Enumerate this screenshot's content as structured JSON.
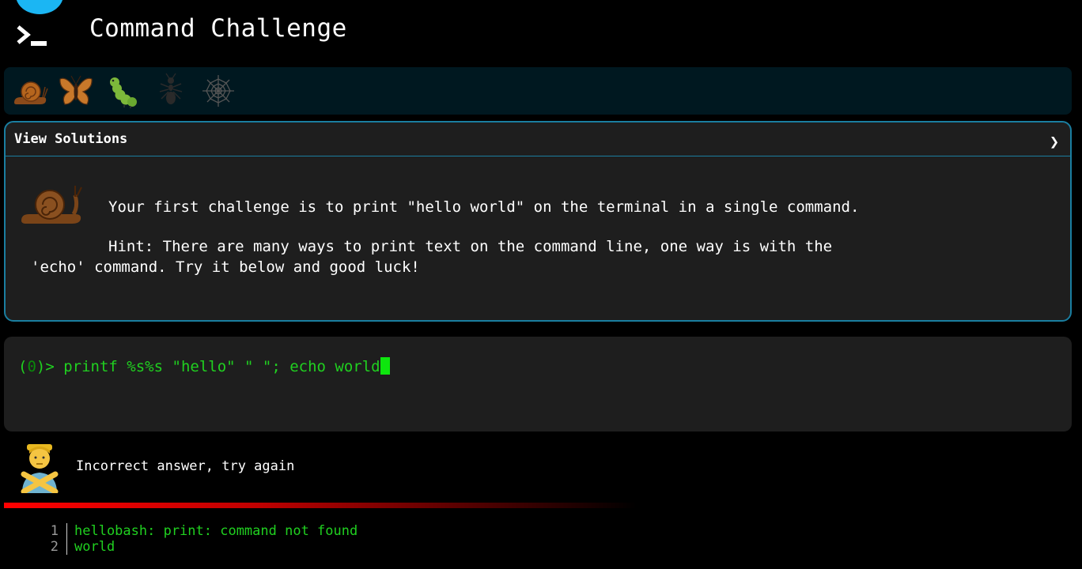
{
  "header": {
    "title": "Command Challenge",
    "accent_color": "#1bb6f3",
    "logo_icon": "terminal-prompt-icon"
  },
  "levels": [
    {
      "name": "snail-icon",
      "color": "#b5651d"
    },
    {
      "name": "butterfly-icon",
      "color": "#c8782a"
    },
    {
      "name": "caterpillar-icon",
      "color": "#7cb83a"
    },
    {
      "name": "ant-icon",
      "color": "#333333"
    },
    {
      "name": "spider-web-icon",
      "color": "#555555"
    }
  ],
  "panel": {
    "solutions_label": "View Solutions",
    "chevron": "❯",
    "challenge_text": "Your first challenge is to print \"hello world\" on the terminal in a single command.",
    "hint_line1": "Hint: There are many ways to print text on the command line, one way is with the",
    "hint_line2": "'echo' command. Try it below and good luck!",
    "border_color": "#1a7ea0"
  },
  "terminal": {
    "prompt_open": "(",
    "exit_code": "0",
    "prompt_close": ")> ",
    "command": "printf %s%s \"hello\" \" \"; echo world"
  },
  "feedback": {
    "message": "Incorrect answer, try again",
    "status_color": "#ff0000"
  },
  "output": {
    "lines": [
      {
        "num": "1",
        "text": "hellobash: print: command not found"
      },
      {
        "num": "2",
        "text": "world"
      }
    ]
  }
}
